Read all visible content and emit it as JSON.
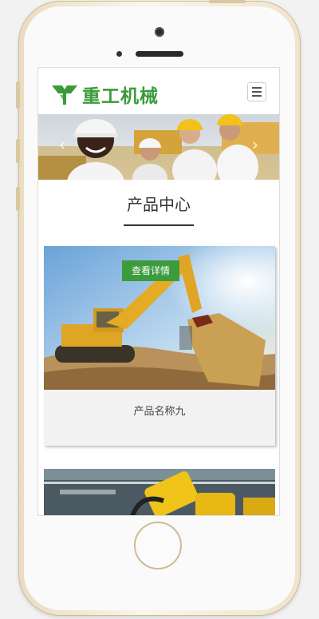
{
  "header": {
    "logo_text": "重工机械",
    "logo_icon": "gear-cube-icon",
    "menu_icon": "hamburger-menu-icon"
  },
  "banner": {
    "prev_icon": "chevron-left-icon",
    "next_icon": "chevron-right-icon",
    "prev_glyph": "‹",
    "next_glyph": "›"
  },
  "products": {
    "section_title": "产品中心",
    "items": [
      {
        "name": "产品名称九",
        "button_label": "查看详情"
      }
    ]
  },
  "colors": {
    "accent": "#3c9b3c",
    "logo_green": "#3a9b3a"
  }
}
